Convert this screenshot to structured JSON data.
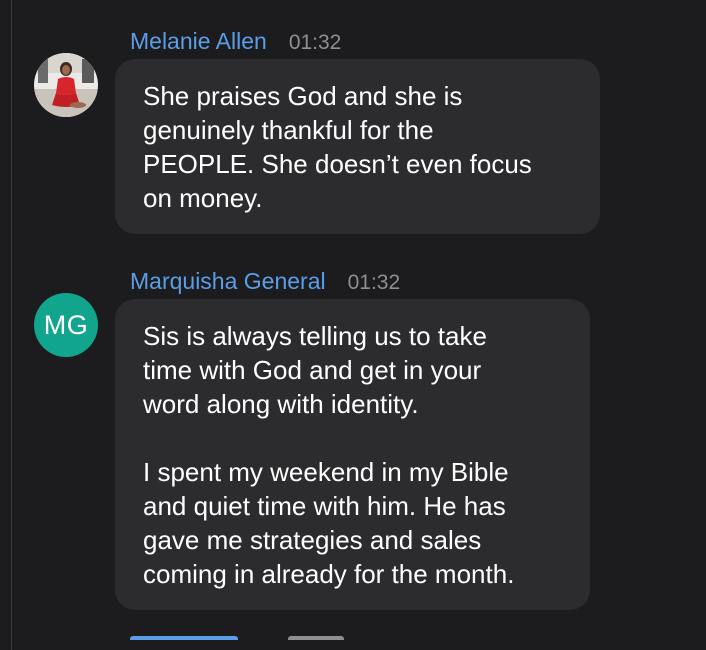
{
  "messages": [
    {
      "author": "Melanie Allen",
      "time": "01:32",
      "avatar_type": "photo",
      "paragraphs": [
        "She praises God and she is\ngenuinely thankful for the\nPEOPLE. She doesn’t even focus\non money."
      ]
    },
    {
      "author": "Marquisha General",
      "time": "01:32",
      "avatar_type": "initials",
      "avatar_initials": "MG",
      "avatar_color": "#12a58e",
      "paragraphs": [
        "Sis is always telling us to take\ntime with God and get in your\nword along with identity.",
        "I spent my weekend in my Bible\nand quiet time with him. He has\ngave me strategies and sales\ncoming in already for the month."
      ]
    }
  ],
  "colors": {
    "background": "#1c1c1e",
    "bubble": "#2c2c2e",
    "author": "#5a9ee8",
    "time": "#8e8e93",
    "text": "#ffffff"
  }
}
